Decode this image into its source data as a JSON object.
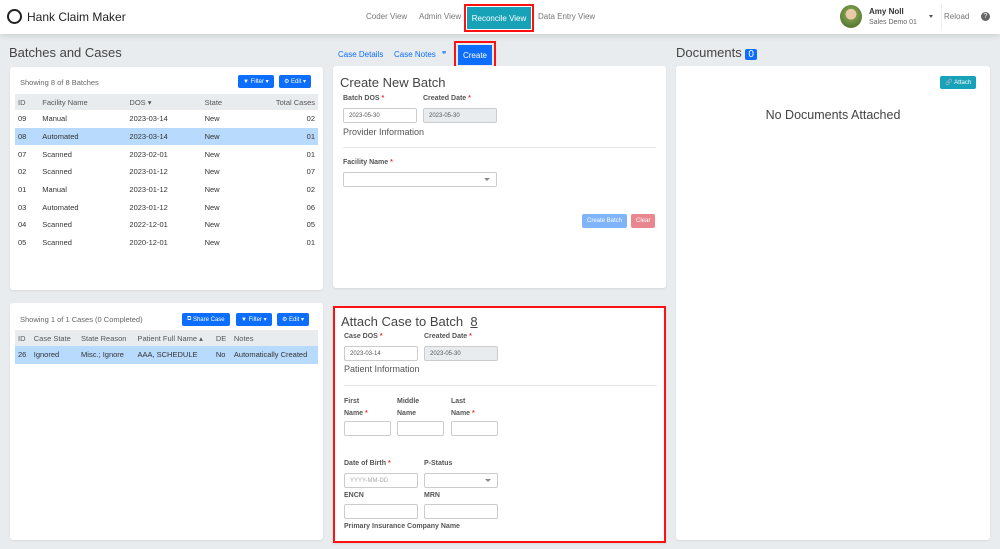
{
  "app": {
    "title": "Hank Claim Maker"
  },
  "nav": {
    "links": [
      "Coder View",
      "Admin View",
      "Reconcile View",
      "Data Entry View"
    ],
    "user_name": "Amy Noll",
    "user_org": "Sales Demo 01",
    "reload": "Reload",
    "help": "?"
  },
  "batches_section": {
    "title": "Batches and Cases",
    "showing": "Showing 8 of 8 Batches",
    "filter": "Filter",
    "edit": "Edit",
    "columns": [
      "ID",
      "Facility Name",
      "DOS",
      "State",
      "Total Cases"
    ],
    "rows": [
      [
        "09",
        "Manual",
        "2023-03-14",
        "New",
        "02"
      ],
      [
        "08",
        "Automated",
        "2023-03-14",
        "New",
        "01"
      ],
      [
        "07",
        "Scanned",
        "2023-02-01",
        "New",
        "01"
      ],
      [
        "02",
        "Scanned",
        "2023-01-12",
        "New",
        "07"
      ],
      [
        "01",
        "Manual",
        "2023-01-12",
        "New",
        "02"
      ],
      [
        "03",
        "Automated",
        "2023-01-12",
        "New",
        "06"
      ],
      [
        "04",
        "Scanned",
        "2022-12-01",
        "New",
        "05"
      ],
      [
        "05",
        "Scanned",
        "2020-12-01",
        "New",
        "01"
      ]
    ]
  },
  "cases_section": {
    "showing": "Showing 1 of 1 Cases (0 Completed)",
    "share": "Share Case",
    "filter": "Filter",
    "edit": "Edit",
    "columns": [
      "ID",
      "Case State",
      "State Reason",
      "Patient Full Name",
      "DE",
      "Notes"
    ],
    "rows": [
      [
        "26",
        "Ignored",
        "Misc.; Ignore",
        "AAA, SCHEDULE",
        "No",
        "Automatically Created"
      ]
    ]
  },
  "middle_tabs": {
    "case_details": "Case Details",
    "case_notes": "Case Notes",
    "create": "Create"
  },
  "create_batch": {
    "title": "Create New Batch",
    "batch_dos_label": "Batch DOS",
    "batch_dos": "2023-05-30",
    "created_label": "Created Date",
    "created": "2023-05-30",
    "provider_info": "Provider Information",
    "facility_label": "Facility Name",
    "facility": "",
    "create_btn": "Create Batch",
    "clear_btn": "Clear"
  },
  "attach_case": {
    "title": "Attach Case to Batch",
    "batch_num": "8",
    "case_dos_label": "Case DOS",
    "case_dos": "2023-03-14",
    "created_label": "Created Date",
    "created": "2023-05-30",
    "patient_info": "Patient Information",
    "first_label_1": "First",
    "first_label_2": "Name",
    "middle_label_1": "Middle",
    "middle_label_2": "Name",
    "last_label_1": "Last",
    "last_label_2": "Name",
    "dob_label": "Date of Birth",
    "dob_placeholder": "YYYY-MM-DD",
    "pstatus_label": "P-Status",
    "encn_label": "ENCN",
    "mrn_label": "MRN",
    "insurance_label": "Primary Insurance Company Name",
    "required": "*"
  },
  "documents": {
    "title": "Documents",
    "count": "0",
    "attach": "Attach",
    "empty": "No Documents Attached"
  },
  "colors": {
    "primary": "#0d6efd",
    "teal": "#17a2b8",
    "highlight": "#f11"
  }
}
